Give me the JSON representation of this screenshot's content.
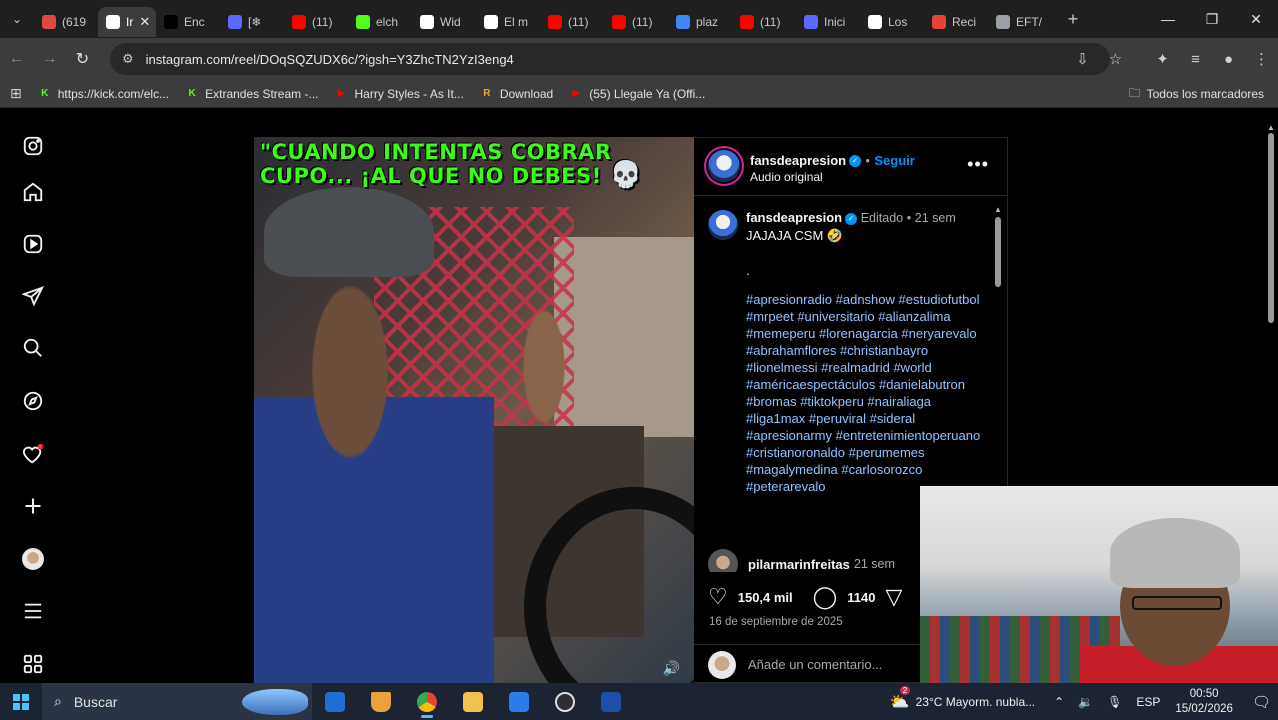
{
  "browser": {
    "tabs": [
      {
        "label": "(619",
        "color": "#e04848"
      },
      {
        "label": "Ir",
        "color": "#ffffff",
        "active": true
      },
      {
        "label": "Enc",
        "color": "#000000"
      },
      {
        "label": "[❄",
        "color": "#5b6bff"
      },
      {
        "label": "(11)",
        "color": "#ff0000"
      },
      {
        "label": "elch",
        "color": "#53fc18"
      },
      {
        "label": "Wid",
        "color": "#ffffff"
      },
      {
        "label": "El m",
        "color": "#ffffff"
      },
      {
        "label": "(11)",
        "color": "#ff0000"
      },
      {
        "label": "(11)",
        "color": "#ff0000"
      },
      {
        "label": "plaz",
        "color": "#4285f4"
      },
      {
        "label": "(11)",
        "color": "#ff0000"
      },
      {
        "label": "Inici",
        "color": "#5b6bff"
      },
      {
        "label": "Los",
        "color": "#ffffff"
      },
      {
        "label": "Reci",
        "color": "#ea4335"
      },
      {
        "label": "EFT/",
        "color": "#9aa0a6"
      }
    ],
    "new_tab": "+",
    "url": "instagram.com/reel/DOqSQZUDX6c/?igsh=Y3ZhcTN2YzI3eng4",
    "bookmarks": [
      {
        "label": "https://kick.com/elc...",
        "icon": "K",
        "color": "#53fc18"
      },
      {
        "label": "Extrandes Stream -...",
        "icon": "K",
        "color": "#53fc18"
      },
      {
        "label": "Harry Styles - As It...",
        "icon": "▶",
        "color": "#ff0000"
      },
      {
        "label": "Download",
        "icon": "R",
        "color": "#e8a33c"
      },
      {
        "label": "(55) Llegale Ya (Offi...",
        "icon": "▶",
        "color": "#ff0000"
      }
    ],
    "all_bookmarks": "Todos los marcadores"
  },
  "reel": {
    "caption_text": "\"CUANDO INTENTAS COBRAR CUPO... ¡AL QUE NO DEBES!",
    "skull": "💀"
  },
  "post": {
    "username": "fansdeapresion",
    "dot": "•",
    "follow": "Seguir",
    "audio": "Audio original",
    "comment_user": "fansdeapresion",
    "edited": "Editado",
    "time": "21 sem",
    "caption": "JAJAJA CSM 🤣",
    "period": ".",
    "hashtags": [
      "#apresionradio",
      "#adnshow",
      "#estudiofutbol",
      "#mrpeet",
      "#universitario",
      "#alianzalima",
      "#memeperu",
      "#lorenagarcia",
      "#neryarevalo",
      "#abrahamflores",
      "#christianbayro",
      "#lionelmessi",
      "#realmadrid",
      "#world",
      "#américaespectáculos",
      "#danielabutron",
      "#bromas",
      "#tiktokperu",
      "#nairaliaga",
      "#liga1max",
      "#peruviral",
      "#sideral",
      "#apresionarmy",
      "#entretenimientoperuano",
      "#cristianoronaldo",
      "#perumemes",
      "#magalymedina",
      "#carlosorozco",
      "#peterarevalo"
    ],
    "second_comment_user": "pilarmarinfreitas",
    "second_comment_time": "21 sem",
    "likes": "150,4 mil",
    "comments_count": "1140",
    "date": "16 de septiembre de 2025",
    "add_comment_placeholder": "Añade un comentario..."
  },
  "taskbar": {
    "search": "Buscar",
    "weather": "23°C  Mayorm. nubla...",
    "weather_badge": "2",
    "lang": "ESP",
    "time": "00:50",
    "date": "15/02/2026"
  },
  "colors": {
    "ig_link": "#0095f6",
    "caption_green": "#39ff14",
    "taskbar_bg": "#1c2433"
  }
}
